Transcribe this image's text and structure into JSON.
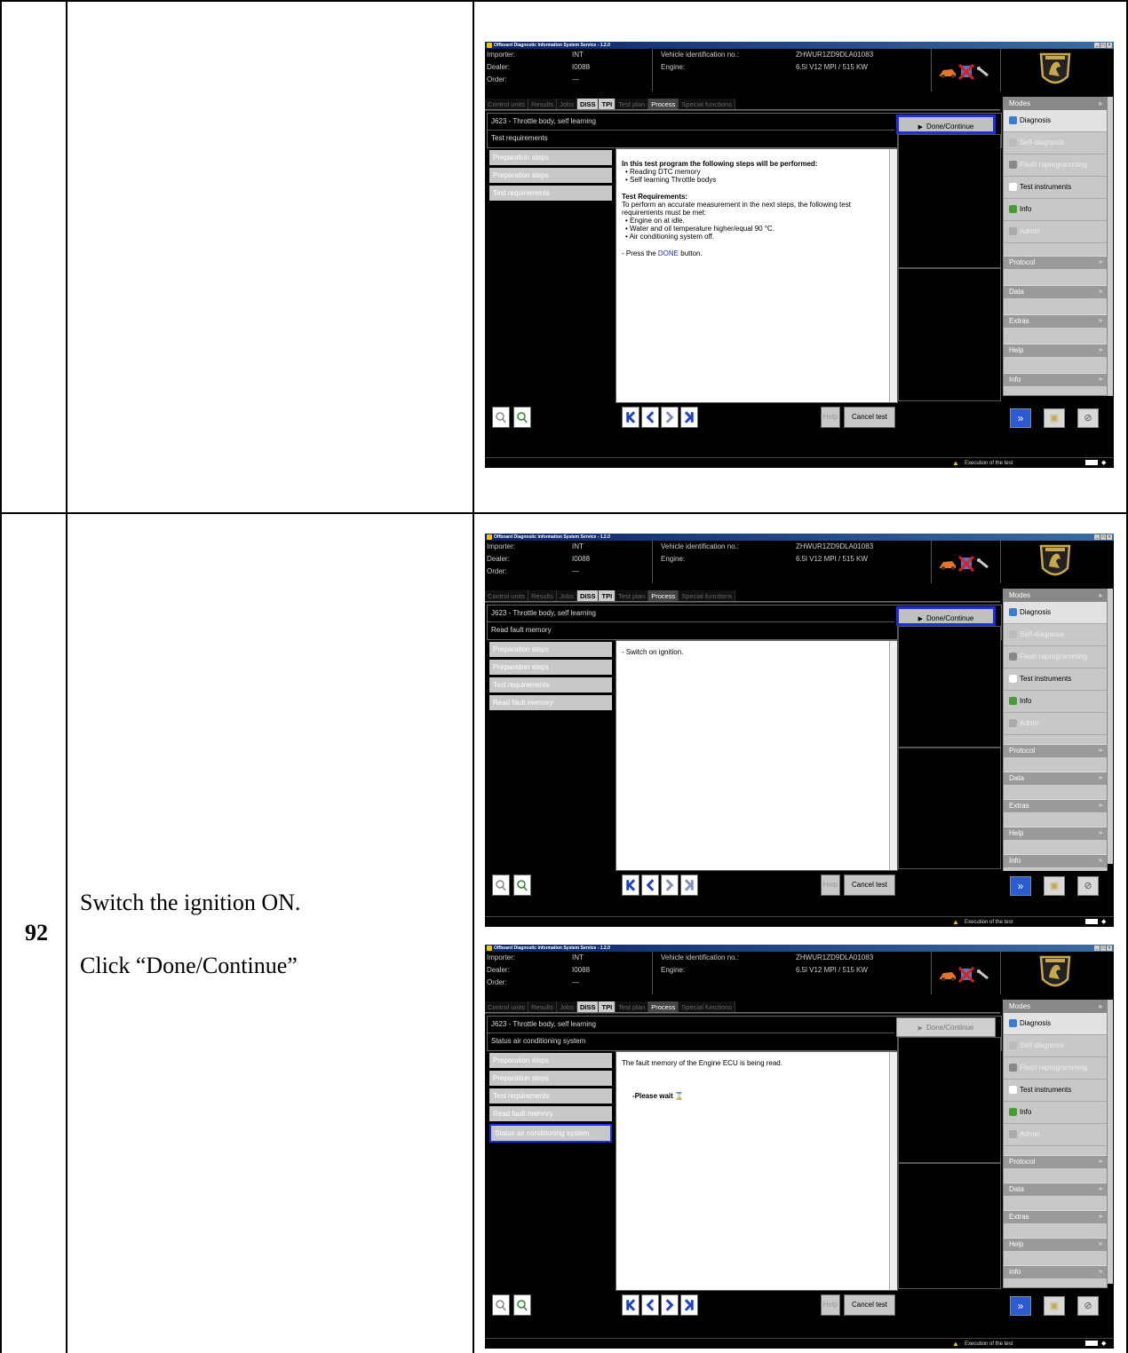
{
  "document": {
    "step_number": "92",
    "instructions": [
      "Switch the ignition ON.",
      "Click “Done/Continue”"
    ]
  },
  "app": {
    "window_title": "Offboard Diagnostic Information System Service - 1.2.0",
    "header": {
      "importer_label": "Importer:",
      "importer_value": "INT",
      "dealer_label": "Dealer:",
      "dealer_value": "I0088",
      "order_label": "Order:",
      "order_value": "—",
      "vin_label": "Vehicle identification no.:",
      "vin_value": "ZHWUR1ZD9DLA01083",
      "engine_label": "Engine:",
      "engine_value": "6.5l V12 MPI / 515 KW"
    },
    "tabs": [
      "Control units",
      "Results",
      "Jobs",
      "DISS",
      "TPI",
      "Test plan",
      "Process",
      "Special functions"
    ],
    "done_label": "Done/Continue",
    "nav": {
      "help": "Help",
      "cancel": "Cancel test"
    },
    "modes": {
      "title": "Modes",
      "items": [
        "Diagnosis",
        "Self-diagnosis",
        "Flash reprogramming",
        "Test instruments",
        "Info",
        "Admin"
      ],
      "sections": [
        "Protocol",
        "Data",
        "Extras",
        "Help",
        "Info"
      ]
    },
    "status_text": "Execution of the test",
    "colors": {
      "highlight": "#1a2fe0",
      "link": "#1a2fe0"
    }
  },
  "screens": [
    {
      "test_title": "J623 - Throttle body, self learning",
      "step_title": "Test requirements",
      "steps": [
        "Preparation steps",
        "Preparation steps",
        "Test requirements"
      ],
      "content": {
        "h1": "In this test program the following steps will be performed:",
        "b1": "Reading DTC memory",
        "b2": "Self learning Throttle bodys",
        "h2": "Test Requirements:",
        "p1": "To perform an accurate measurement in the next steps, the following test requirements must be met:",
        "b3": "Engine on at idle.",
        "b4": "Water and oil temperature higher/equal 90 °C.",
        "b5": "Air conditioning system off.",
        "p2a": "- Press the ",
        "p2b": "DONE",
        "p2c": " button."
      }
    },
    {
      "test_title": "J623 - Throttle body, self learning",
      "step_title": "Read fault memory",
      "steps": [
        "Preparation steps",
        "Preparation steps",
        "Test requirements",
        "Read fault memory"
      ],
      "content": {
        "line1": "- Switch on ignition."
      }
    },
    {
      "test_title": "J623 - Throttle body, self learning",
      "step_title": "Status air conditioning system",
      "steps": [
        "Preparation steps",
        "Preparation steps",
        "Test requirements",
        "Read fault memory",
        "Status air conditioning system"
      ],
      "content": {
        "line1": "The fault memory of the Engine ECU is being read.",
        "line2": "-Please wait"
      }
    }
  ]
}
